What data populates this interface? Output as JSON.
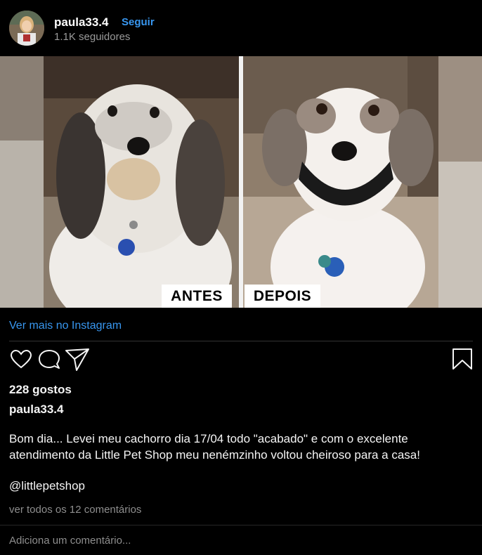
{
  "header": {
    "username": "paula33.4",
    "follow_label": "Seguir",
    "followers": "1.1K seguidores"
  },
  "media": {
    "label_before": "ANTES",
    "label_after": "DEPOIS"
  },
  "see_more": "Ver mais no Instagram",
  "actions": {
    "like_icon": "heart-icon",
    "comment_icon": "comment-icon",
    "share_icon": "paper-plane-icon",
    "save_icon": "bookmark-icon"
  },
  "post": {
    "likes": "228 gostos",
    "author": "paula33.4",
    "caption": "Bom dia... Levei meu cachorro dia 17/04 todo \"acabado\" e com o excelente atendimento da Little Pet Shop meu nenémzinho voltou cheiroso para a casa!",
    "mention": "@littlepetshop",
    "view_comments": "ver todos os 12 comentários",
    "add_comment_placeholder": "Adiciona um comentário..."
  },
  "colors": {
    "background": "#000000",
    "link": "#3897f0",
    "muted": "#8e8e8e"
  }
}
